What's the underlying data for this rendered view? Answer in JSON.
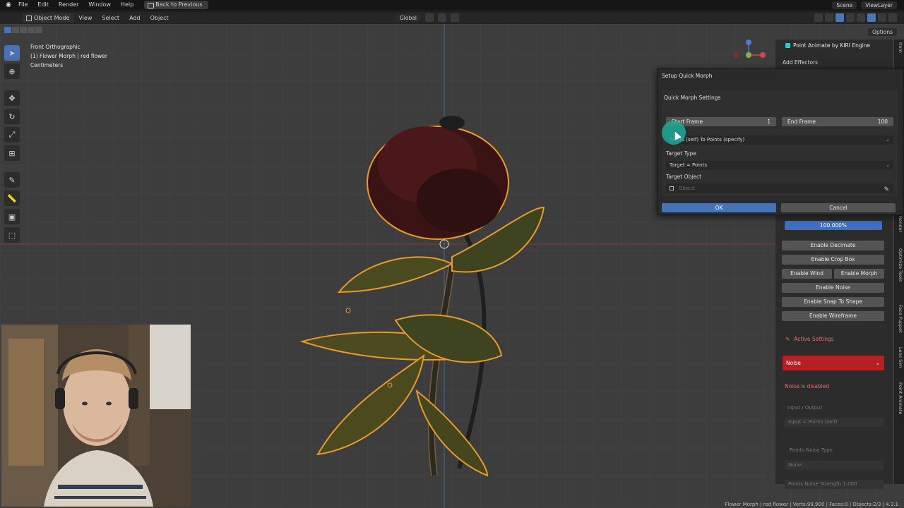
{
  "topbar": {
    "menus": [
      "File",
      "Edit",
      "Render",
      "Window",
      "Help"
    ],
    "back_label": "Back to Previous",
    "scene": "Scene",
    "view_layer": "ViewLayer"
  },
  "header": {
    "mode": "Object Mode",
    "menus": [
      "View",
      "Select",
      "Add",
      "Object"
    ],
    "orientation": "Global",
    "options": "Options"
  },
  "viewport": {
    "view_name": "Front Orthographic",
    "object_line": "(1) Flower Morph | red flower",
    "units": "Centimeters"
  },
  "sidebar": {
    "addon_title": "Point Animate by KIRI Engine",
    "add_effectors": "Add Effectors",
    "progress": "100.000%",
    "progress_value": 1.0,
    "buttons": {
      "decimate": "Enable Decimate",
      "crop": "Enable Crop Box",
      "wind": "Enable Wind",
      "morph": "Enable Morph",
      "noise": "Enable Noise",
      "snap": "Enable Snap To Shape",
      "wireframe": "Enable Wireframe"
    },
    "active_settings": "Active Settings",
    "active_effect": "Noise",
    "disabled_msg": "Noise is disabled",
    "io_label": "Input / Output",
    "io_value": "Input = Points (self)",
    "noise_type_label": "Points Noise Type",
    "noise_type_value": "Noise",
    "noise_strength": "Points Noise Strength  1.000"
  },
  "tabs": [
    "Item",
    "Render",
    "Optimize Tools",
    "Face Puppet",
    "Lens Sim",
    "Point Animate"
  ],
  "dialog": {
    "title": "Setup Quick Morph",
    "section": "Quick Morph Settings",
    "start_frame_label": "Start Frame",
    "start_frame_value": "1",
    "end_frame_label": "End Frame",
    "end_frame_value": "100",
    "mode_value": "Points (self) To Points (specify)",
    "target_type_label": "Target Type",
    "target_type_value": "Target = Points",
    "target_object_label": "Target Object",
    "target_object_placeholder": "Object",
    "ok": "OK",
    "cancel": "Cancel"
  },
  "status": "Flower Morph | red flower | Verts:99,900 | Faces:0 | Objects:2/3 | 4.3.1",
  "colors": {
    "accent_blue": "#4772b3",
    "noise_red": "#b52024",
    "selection_orange": "#e89a2a",
    "cursor_teal": "#1eaa96"
  }
}
